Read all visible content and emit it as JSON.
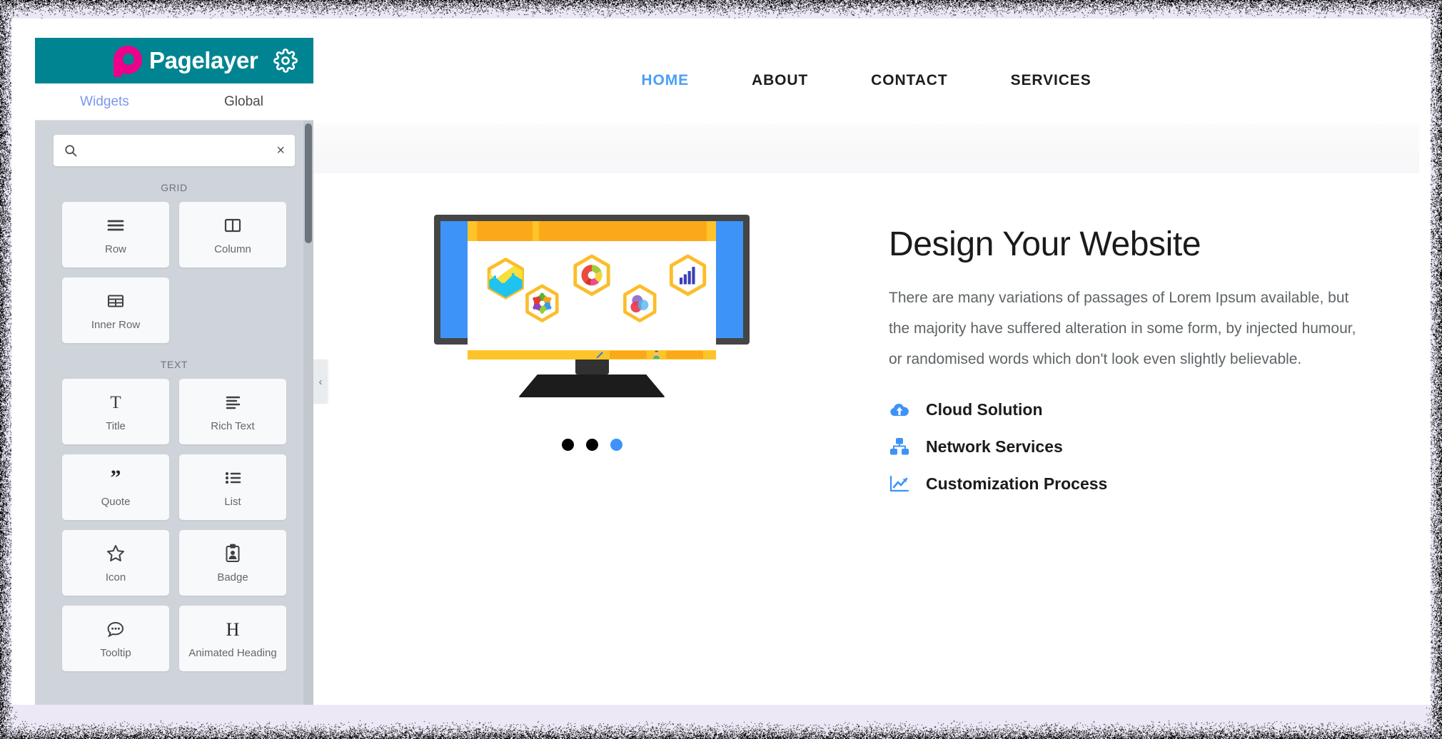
{
  "app": {
    "brand_name": "Pagelayer",
    "settings_icon": "gear-icon",
    "logo_icon": "pagelayer-logo-icon"
  },
  "sidebar": {
    "tabs": [
      {
        "label": "Widgets",
        "active": true
      },
      {
        "label": "Global",
        "active": false
      }
    ],
    "search": {
      "placeholder": "",
      "value": "",
      "icon": "search-icon",
      "clear_icon": "clear-x-icon",
      "clear_label": "×"
    },
    "groups": [
      {
        "label": "GRID",
        "widgets": [
          {
            "label": "Row",
            "icon": "rows-icon"
          },
          {
            "label": "Column",
            "icon": "columns-icon"
          },
          {
            "label": "Inner Row",
            "icon": "table-icon"
          }
        ]
      },
      {
        "label": "TEXT",
        "widgets": [
          {
            "label": "Title",
            "icon": "text-title-icon"
          },
          {
            "label": "Rich Text",
            "icon": "align-left-icon"
          },
          {
            "label": "Quote",
            "icon": "quote-icon"
          },
          {
            "label": "List",
            "icon": "bullet-list-icon"
          },
          {
            "label": "Icon",
            "icon": "star-icon"
          },
          {
            "label": "Badge",
            "icon": "id-badge-icon"
          },
          {
            "label": "Tooltip",
            "icon": "speech-bubble-icon"
          },
          {
            "label": "Animated Heading",
            "icon": "heading-h-icon"
          }
        ]
      }
    ],
    "collapse_toggle": {
      "icon": "chevron-left-icon",
      "glyph": "‹"
    },
    "scrollbar": {
      "name": "sidebar-scrollbar"
    }
  },
  "preview": {
    "nav": [
      {
        "label": "HOME",
        "active": true
      },
      {
        "label": "ABOUT",
        "active": false
      },
      {
        "label": "CONTACT",
        "active": false
      },
      {
        "label": "SERVICES",
        "active": false
      }
    ],
    "hero": {
      "title": "Design Your Website",
      "paragraph": "There are many variations of passages of Lorem Ipsum available, but the majority have suffered alteration in some form, by injected humour, or randomised words which don't look even slightly believable.",
      "features": [
        {
          "label": "Cloud Solution",
          "icon": "cloud-upload-icon"
        },
        {
          "label": "Network Services",
          "icon": "sitemap-icon"
        },
        {
          "label": "Customization Process",
          "icon": "line-chart-icon"
        }
      ],
      "illustration": {
        "name": "desktop-monitor-illustration",
        "hex_icons": [
          "area-chart-hex-icon",
          "teamwork-ring-hex-icon",
          "donut-chart-hex-icon",
          "venn-circles-hex-icon",
          "bar-chart-hex-icon"
        ]
      },
      "carousel_dots": [
        {
          "active": false
        },
        {
          "active": false
        },
        {
          "active": true
        }
      ]
    }
  },
  "colors": {
    "brand_teal": "#008491",
    "brand_pink": "#ec008c",
    "accent_blue": "#3d93f7",
    "tab_active": "#7b96f0",
    "sidebar_bg": "#ced4da",
    "page_bg": "#ece8f5",
    "screen_yellow": "#fdc42a",
    "screen_orange": "#fba919"
  }
}
